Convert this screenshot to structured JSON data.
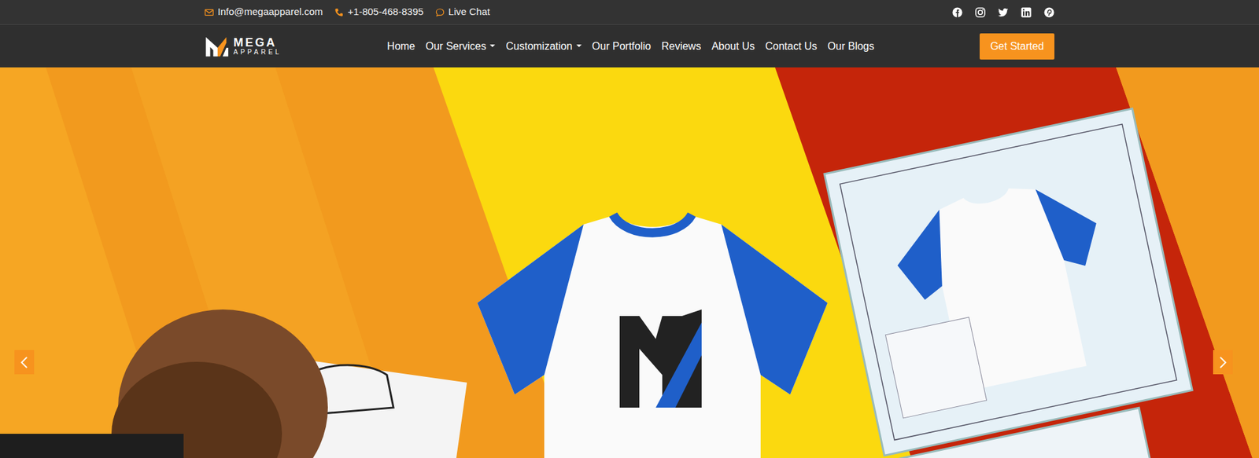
{
  "top_bar": {
    "contacts": [
      {
        "label": "Info@megaapparel.com",
        "kind": "email"
      },
      {
        "label": "+1-805-468-8395",
        "kind": "phone"
      },
      {
        "label": "Live Chat",
        "kind": "chat"
      }
    ],
    "social": [
      {
        "kind": "facebook"
      },
      {
        "kind": "instagram"
      },
      {
        "kind": "twitter"
      },
      {
        "kind": "linkedin"
      },
      {
        "kind": "pinterest"
      }
    ]
  },
  "logo": {
    "title": "MEGA",
    "subtitle": "APPAREL"
  },
  "nav": [
    {
      "label": "Home",
      "dropdown": false
    },
    {
      "label": "Our Services",
      "dropdown": true
    },
    {
      "label": "Customization",
      "dropdown": true
    },
    {
      "label": "Our Portfolio",
      "dropdown": false
    },
    {
      "label": "Reviews",
      "dropdown": false
    },
    {
      "label": "About Us",
      "dropdown": false
    },
    {
      "label": "Contact Us",
      "dropdown": false
    },
    {
      "label": "Our Blogs",
      "dropdown": false
    }
  ],
  "cta": "Get Started"
}
